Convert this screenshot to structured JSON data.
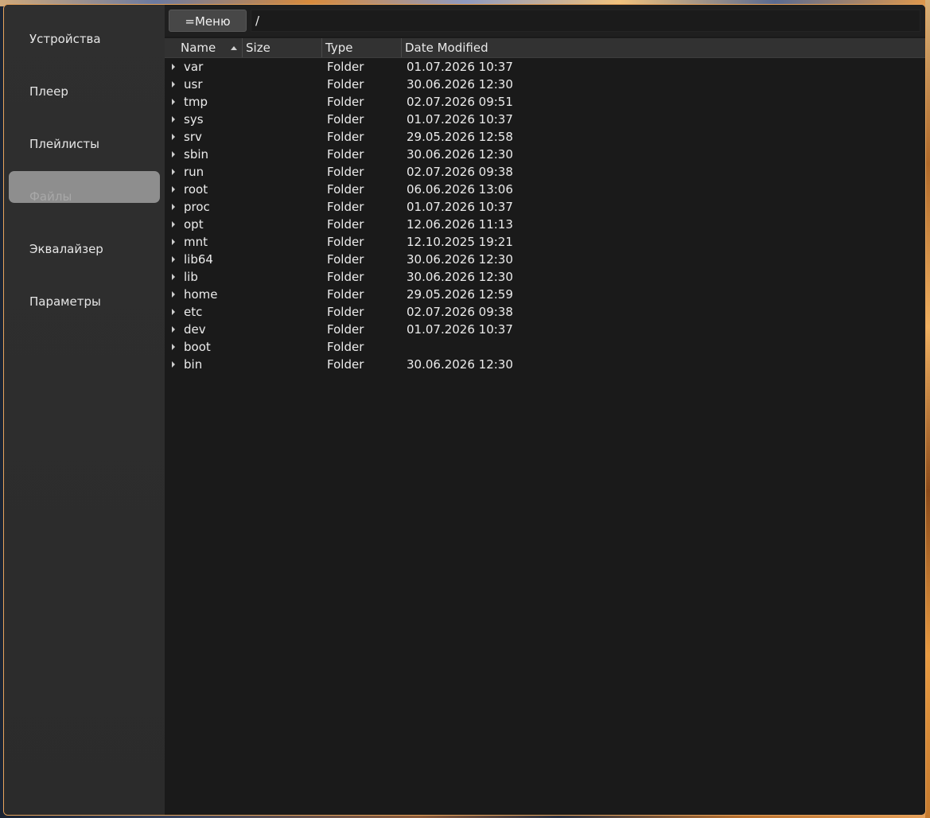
{
  "sidebar": {
    "items": [
      {
        "label": "Устройства"
      },
      {
        "label": "Плеер"
      },
      {
        "label": "Плейлисты"
      },
      {
        "label": "Файлы"
      },
      {
        "label": "Эквалайзер"
      },
      {
        "label": "Параметры"
      }
    ],
    "active_index": 3
  },
  "toolbar": {
    "menu_label": "=Меню",
    "path": "/"
  },
  "table": {
    "columns": [
      "Name",
      "Size",
      "Type",
      "Date Modified"
    ],
    "sort_column": "Name",
    "sort_direction": "ascending",
    "rows": [
      {
        "name": "var",
        "size": "",
        "type": "Folder",
        "date": "01.07.2026 10:37"
      },
      {
        "name": "usr",
        "size": "",
        "type": "Folder",
        "date": "30.06.2026 12:30"
      },
      {
        "name": "tmp",
        "size": "",
        "type": "Folder",
        "date": "02.07.2026 09:51"
      },
      {
        "name": "sys",
        "size": "",
        "type": "Folder",
        "date": "01.07.2026 10:37"
      },
      {
        "name": "srv",
        "size": "",
        "type": "Folder",
        "date": "29.05.2026 12:58"
      },
      {
        "name": "sbin",
        "size": "",
        "type": "Folder",
        "date": "30.06.2026 12:30"
      },
      {
        "name": "run",
        "size": "",
        "type": "Folder",
        "date": "02.07.2026 09:38"
      },
      {
        "name": "root",
        "size": "",
        "type": "Folder",
        "date": "06.06.2026 13:06"
      },
      {
        "name": "proc",
        "size": "",
        "type": "Folder",
        "date": "01.07.2026 10:37"
      },
      {
        "name": "opt",
        "size": "",
        "type": "Folder",
        "date": "12.06.2026 11:13"
      },
      {
        "name": "mnt",
        "size": "",
        "type": "Folder",
        "date": "12.10.2025 19:21"
      },
      {
        "name": "lib64",
        "size": "",
        "type": "Folder",
        "date": "30.06.2026 12:30"
      },
      {
        "name": "lib",
        "size": "",
        "type": "Folder",
        "date": "30.06.2026 12:30"
      },
      {
        "name": "home",
        "size": "",
        "type": "Folder",
        "date": "29.05.2026 12:59"
      },
      {
        "name": "etc",
        "size": "",
        "type": "Folder",
        "date": "02.07.2026 09:38"
      },
      {
        "name": "dev",
        "size": "",
        "type": "Folder",
        "date": "01.07.2026 10:37"
      },
      {
        "name": "boot",
        "size": "",
        "type": "Folder",
        "date": ""
      },
      {
        "name": "bin",
        "size": "",
        "type": "Folder",
        "date": "30.06.2026 12:30"
      }
    ]
  },
  "colors": {
    "window_border": "#e7a45c",
    "sidebar_bg": "#2d2d2d",
    "content_bg": "#1a1a1a",
    "active_item_bg": "#8e8e8e",
    "header_bg": "#323232"
  }
}
